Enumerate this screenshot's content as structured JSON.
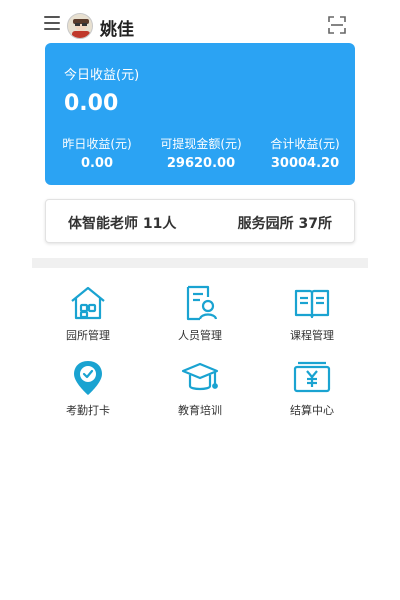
{
  "header": {
    "username": "姚佳",
    "menu_icon": "hamburger-menu-icon",
    "scan_icon": "scan-icon"
  },
  "earnings": {
    "today_label": "今日收益(元)",
    "today_value": "0.00",
    "stats": [
      {
        "label": "昨日收益(元)",
        "value": "0.00"
      },
      {
        "label": "可提现金额(元)",
        "value": "29620.00"
      },
      {
        "label": "合计收益(元)",
        "value": "30004.20"
      }
    ],
    "card_color": "#2ba3f3"
  },
  "summary": {
    "teachers": "体智能老师 11人",
    "kindergartens": "服务园所 37所"
  },
  "grid": {
    "accent_color": "#1aa3d1",
    "items": [
      {
        "label": "园所管理",
        "icon": "kindergarten-house-icon"
      },
      {
        "label": "人员管理",
        "icon": "staff-document-icon"
      },
      {
        "label": "课程管理",
        "icon": "course-book-icon"
      },
      {
        "label": "考勤打卡",
        "icon": "attendance-checkin-icon"
      },
      {
        "label": "教育培训",
        "icon": "graduation-cap-icon"
      },
      {
        "label": "结算中心",
        "icon": "settlement-yen-icon"
      }
    ]
  }
}
